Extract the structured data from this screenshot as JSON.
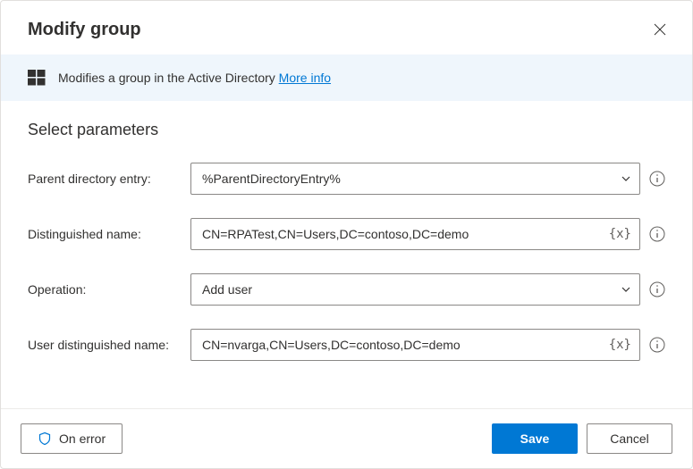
{
  "dialog": {
    "title": "Modify group"
  },
  "banner": {
    "text": "Modifies a group in the Active Directory ",
    "more_info": "More info"
  },
  "section": {
    "title": "Select parameters"
  },
  "fields": {
    "parent": {
      "label": "Parent directory entry:",
      "value": "%ParentDirectoryEntry%"
    },
    "dn": {
      "label": "Distinguished name:",
      "value": "CN=RPATest,CN=Users,DC=contoso,DC=demo"
    },
    "operation": {
      "label": "Operation:",
      "value": "Add user"
    },
    "user_dn": {
      "label": "User distinguished name:",
      "value": "CN=nvarga,CN=Users,DC=contoso,DC=demo"
    }
  },
  "footer": {
    "on_error": "On error",
    "save": "Save",
    "cancel": "Cancel"
  },
  "icons": {
    "variable": "{x}"
  }
}
